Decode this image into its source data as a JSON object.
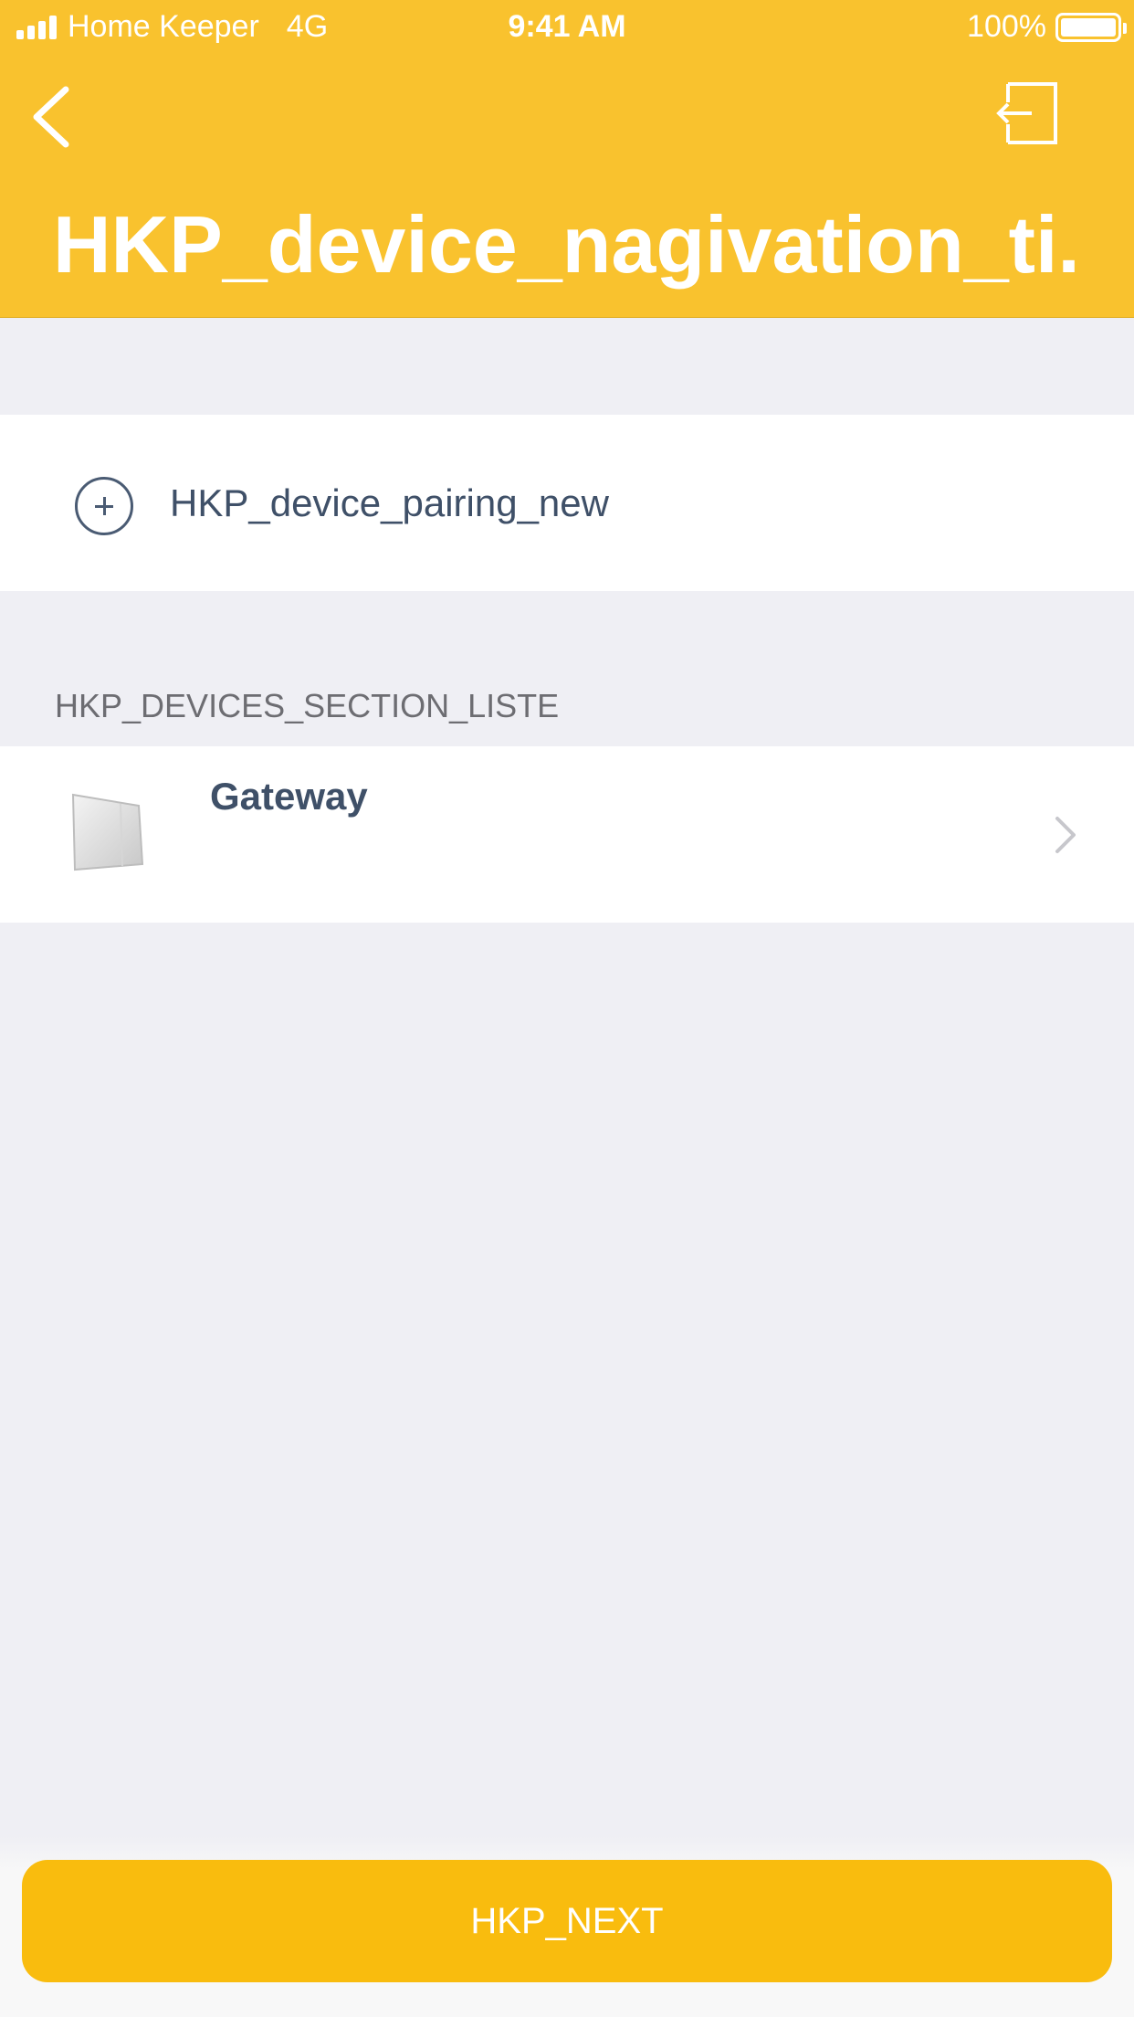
{
  "status_bar": {
    "carrier": "Home Keeper",
    "network": "4G",
    "time": "9:41 AM",
    "battery": "100%"
  },
  "header": {
    "title": "HKP_device_nagivation_ti...",
    "back_icon": "chevron-left-icon",
    "logout_icon": "logout-icon"
  },
  "add_row": {
    "label": "HKP_device_pairing_new",
    "icon": "plus-circle-icon"
  },
  "devices_section": {
    "header": "HKP_DEVICES_SECTION_LISTE",
    "items": [
      {
        "name": "Gateway",
        "icon": "gateway-device-image"
      }
    ]
  },
  "footer": {
    "next_label": "HKP_NEXT"
  },
  "colors": {
    "header_bg": "#f9c22e",
    "button_bg": "#f9bc0e",
    "text_dark": "#3f5068",
    "background": "#efeff4"
  }
}
